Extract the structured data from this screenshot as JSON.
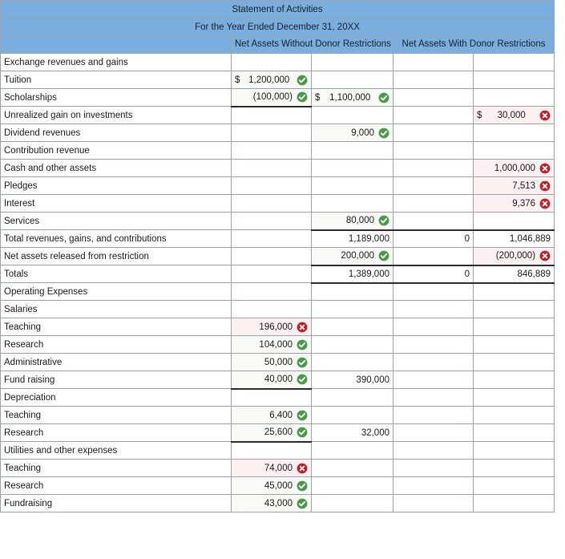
{
  "statement": {
    "title": "Statement of Activities",
    "subtitle": "For the Year Ended December 31, 20XX"
  },
  "columns": {
    "blank": "",
    "without_donor": "Net Assets Without Donor Restrictions",
    "with_donor": "Net Assets With Donor Restrictions"
  },
  "icons": {
    "correct": "check-circle-icon",
    "incorrect": "x-circle-icon"
  },
  "colors": {
    "header_blue": "#7aaede",
    "correct_green": "#4a9a4a",
    "incorrect_red": "#c0202a",
    "correct_cell_bg": "#f7faf5",
    "incorrect_cell_bg": "#fdf0f0",
    "grid_line": "#9aa3ad",
    "rule_line": "#2b2b2b",
    "text": "#1a1a1a"
  },
  "rows": [
    {
      "label": "Exchange revenues and gains",
      "indent": 0,
      "cells": [
        {
          "value": "",
          "state": "none"
        },
        {
          "value": "",
          "state": "none"
        },
        {
          "value": "",
          "state": "none"
        },
        {
          "value": "",
          "state": "none"
        }
      ]
    },
    {
      "label": "Tuition",
      "indent": 1,
      "cells": [
        {
          "value": "1,200,000",
          "dollar": "$",
          "state": "correct"
        },
        {
          "value": "",
          "state": "none"
        },
        {
          "value": "",
          "state": "none"
        },
        {
          "value": "",
          "state": "none"
        }
      ]
    },
    {
      "label": "Scholarships",
      "indent": 1,
      "cells": [
        {
          "value": "(100,000)",
          "state": "correct",
          "rule": "underline"
        },
        {
          "value": "1,100,000",
          "dollar": "$",
          "state": "correct"
        },
        {
          "value": "",
          "state": "none"
        },
        {
          "value": "",
          "state": "none"
        }
      ]
    },
    {
      "label": "Unrealized gain on investments",
      "indent": 1,
      "cells": [
        {
          "value": "",
          "state": "none"
        },
        {
          "value": "",
          "state": "none"
        },
        {
          "value": "",
          "state": "none"
        },
        {
          "value": "30,000",
          "dollar": "$",
          "state": "incorrect"
        }
      ]
    },
    {
      "label": "Dividend revenues",
      "indent": 1,
      "cells": [
        {
          "value": "",
          "state": "none"
        },
        {
          "value": "9,000",
          "state": "correct"
        },
        {
          "value": "",
          "state": "none"
        },
        {
          "value": "",
          "state": "none"
        }
      ]
    },
    {
      "label": "Contribution revenue",
      "indent": 0,
      "cells": [
        {
          "value": "",
          "state": "none"
        },
        {
          "value": "",
          "state": "none"
        },
        {
          "value": "",
          "state": "none"
        },
        {
          "value": "",
          "state": "none"
        }
      ]
    },
    {
      "label": "Cash and other assets",
      "indent": 1,
      "cells": [
        {
          "value": "",
          "state": "none"
        },
        {
          "value": "",
          "state": "none"
        },
        {
          "value": "",
          "state": "none"
        },
        {
          "value": "1,000,000",
          "state": "incorrect"
        }
      ]
    },
    {
      "label": "Pledges",
      "indent": 1,
      "cells": [
        {
          "value": "",
          "state": "none"
        },
        {
          "value": "",
          "state": "none"
        },
        {
          "value": "",
          "state": "none"
        },
        {
          "value": "7,513",
          "state": "incorrect"
        }
      ]
    },
    {
      "label": "Interest",
      "indent": 1,
      "cells": [
        {
          "value": "",
          "state": "none"
        },
        {
          "value": "",
          "state": "none"
        },
        {
          "value": "",
          "state": "none"
        },
        {
          "value": "9,376",
          "state": "incorrect"
        }
      ]
    },
    {
      "label": "Services",
      "indent": 1,
      "cells": [
        {
          "value": "",
          "state": "none"
        },
        {
          "value": "80,000",
          "state": "correct",
          "rule": "underline"
        },
        {
          "value": "",
          "state": "none",
          "rule": "underline"
        },
        {
          "value": "",
          "state": "none",
          "rule": "underline"
        }
      ]
    },
    {
      "label": "Total revenues, gains, and contributions",
      "indent": 0,
      "cells": [
        {
          "value": "",
          "state": "none"
        },
        {
          "value": "1,189,000",
          "state": "none"
        },
        {
          "value": "0",
          "state": "none"
        },
        {
          "value": "1,046,889",
          "state": "none"
        }
      ]
    },
    {
      "label": "Net assets released from restriction",
      "indent": 0,
      "cells": [
        {
          "value": "",
          "state": "none"
        },
        {
          "value": "200,000",
          "state": "correct",
          "rule": "underline"
        },
        {
          "value": "",
          "state": "none",
          "rule": "underline"
        },
        {
          "value": "(200,000)",
          "state": "incorrect",
          "rule": "underline"
        }
      ]
    },
    {
      "label": "Totals",
      "indent": 0,
      "cells": [
        {
          "value": "",
          "state": "none"
        },
        {
          "value": "1,389,000",
          "state": "none",
          "rule": "underline"
        },
        {
          "value": "0",
          "state": "none",
          "rule": "underline"
        },
        {
          "value": "846,889",
          "state": "none",
          "rule": "underline"
        }
      ]
    },
    {
      "label": "Operating Expenses",
      "indent": 0,
      "cells": [
        {
          "value": "",
          "state": "none"
        },
        {
          "value": "",
          "state": "none"
        },
        {
          "value": "",
          "state": "none"
        },
        {
          "value": "",
          "state": "none"
        }
      ]
    },
    {
      "label": "Salaries",
      "indent": 1,
      "cells": [
        {
          "value": "",
          "state": "none"
        },
        {
          "value": "",
          "state": "none"
        },
        {
          "value": "",
          "state": "none"
        },
        {
          "value": "",
          "state": "none"
        }
      ]
    },
    {
      "label": "Teaching",
      "indent": 2,
      "cells": [
        {
          "value": "196,000",
          "state": "incorrect"
        },
        {
          "value": "",
          "state": "none"
        },
        {
          "value": "",
          "state": "none"
        },
        {
          "value": "",
          "state": "none"
        }
      ]
    },
    {
      "label": "Research",
      "indent": 2,
      "cells": [
        {
          "value": "104,000",
          "state": "correct"
        },
        {
          "value": "",
          "state": "none"
        },
        {
          "value": "",
          "state": "none"
        },
        {
          "value": "",
          "state": "none"
        }
      ]
    },
    {
      "label": "Administrative",
      "indent": 2,
      "cells": [
        {
          "value": "50,000",
          "state": "correct"
        },
        {
          "value": "",
          "state": "none"
        },
        {
          "value": "",
          "state": "none"
        },
        {
          "value": "",
          "state": "none"
        }
      ]
    },
    {
      "label": "Fund raising",
      "indent": 2,
      "cells": [
        {
          "value": "40,000",
          "state": "correct",
          "rule": "underline"
        },
        {
          "value": "390,000",
          "state": "none"
        },
        {
          "value": "",
          "state": "none"
        },
        {
          "value": "",
          "state": "none"
        }
      ]
    },
    {
      "label": "Depreciation",
      "indent": 1,
      "cells": [
        {
          "value": "",
          "state": "none"
        },
        {
          "value": "",
          "state": "none"
        },
        {
          "value": "",
          "state": "none"
        },
        {
          "value": "",
          "state": "none"
        }
      ]
    },
    {
      "label": "Teaching",
      "indent": 2,
      "cells": [
        {
          "value": "6,400",
          "state": "correct"
        },
        {
          "value": "",
          "state": "none"
        },
        {
          "value": "",
          "state": "none"
        },
        {
          "value": "",
          "state": "none"
        }
      ]
    },
    {
      "label": "Research",
      "indent": 2,
      "cells": [
        {
          "value": "25,600",
          "state": "correct",
          "rule": "underline"
        },
        {
          "value": "32,000",
          "state": "none"
        },
        {
          "value": "",
          "state": "none"
        },
        {
          "value": "",
          "state": "none"
        }
      ]
    },
    {
      "label": "Utilities and other expenses",
      "indent": 0,
      "cells": [
        {
          "value": "",
          "state": "none"
        },
        {
          "value": "",
          "state": "none"
        },
        {
          "value": "",
          "state": "none"
        },
        {
          "value": "",
          "state": "none"
        }
      ]
    },
    {
      "label": "Teaching",
      "indent": 2,
      "cells": [
        {
          "value": "74,000",
          "state": "incorrect"
        },
        {
          "value": "",
          "state": "none"
        },
        {
          "value": "",
          "state": "none"
        },
        {
          "value": "",
          "state": "none"
        }
      ]
    },
    {
      "label": "Research",
      "indent": 2,
      "cells": [
        {
          "value": "45,000",
          "state": "correct"
        },
        {
          "value": "",
          "state": "none"
        },
        {
          "value": "",
          "state": "none"
        },
        {
          "value": "",
          "state": "none"
        }
      ]
    },
    {
      "label": "Fundraising",
      "indent": 2,
      "cells": [
        {
          "value": "43,000",
          "state": "correct"
        },
        {
          "value": "",
          "state": "none"
        },
        {
          "value": "",
          "state": "none"
        },
        {
          "value": "",
          "state": "none"
        }
      ]
    }
  ]
}
